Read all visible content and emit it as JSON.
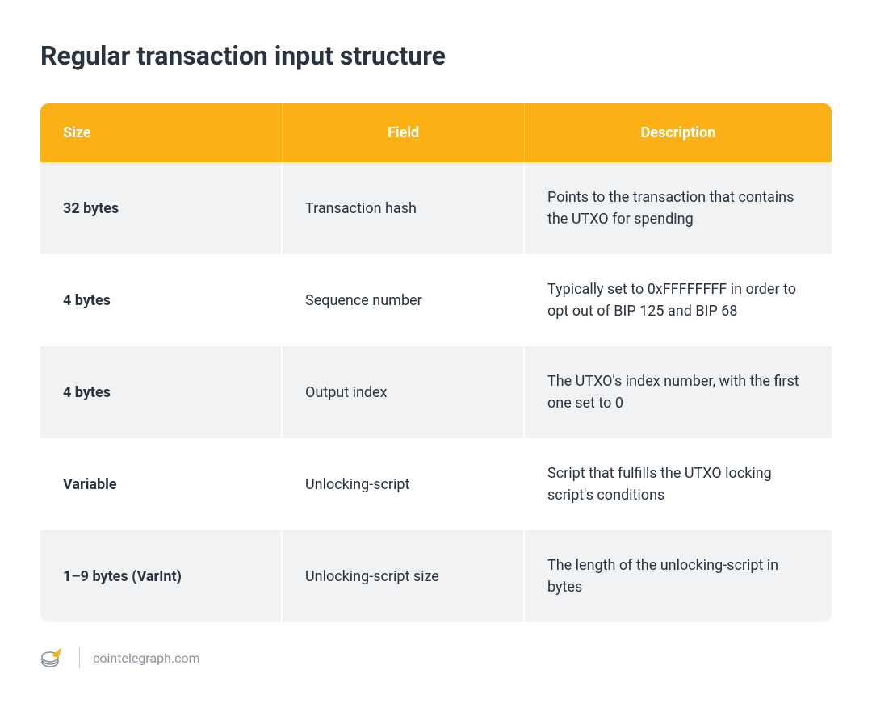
{
  "title": "Regular transaction input structure",
  "headers": {
    "size": "Size",
    "field": "Field",
    "description": "Description"
  },
  "rows": [
    {
      "size": "32 bytes",
      "field": "Transaction hash",
      "description": "Points to the transaction that contains the UTXO for spending"
    },
    {
      "size": "4 bytes",
      "field": "Sequence number",
      "description": "Typically set to 0xFFFFFFFF in order to opt out of BIP 125 and BIP 68"
    },
    {
      "size": "4 bytes",
      "field": "Output index",
      "description": "The UTXO's index number, with the first one set to 0"
    },
    {
      "size": "Variable",
      "field": "Unlocking-script",
      "description": "Script that fulfills the UTXO locking script's conditions"
    },
    {
      "size": "1–9 bytes (VarInt)",
      "field": "Unlocking-script size",
      "description": "The length of the unlocking-script in bytes"
    }
  ],
  "footer": {
    "site": "cointelegraph.com"
  },
  "chart_data": {
    "type": "table",
    "title": "Regular transaction input structure",
    "columns": [
      "Size",
      "Field",
      "Description"
    ],
    "rows": [
      [
        "32 bytes",
        "Transaction hash",
        "Points to the transaction that contains the UTXO for spending"
      ],
      [
        "4 bytes",
        "Sequence number",
        "Typically set to 0xFFFFFFFF in order to opt out of BIP 125 and BIP 68"
      ],
      [
        "4 bytes",
        "Output index",
        "The UTXO's index number, with the first one set to 0"
      ],
      [
        "Variable",
        "Unlocking-script",
        "Script that fulfills the UTXO locking script's conditions"
      ],
      [
        "1–9 bytes (VarInt)",
        "Unlocking-script size",
        "The length of the unlocking-script in bytes"
      ]
    ]
  }
}
